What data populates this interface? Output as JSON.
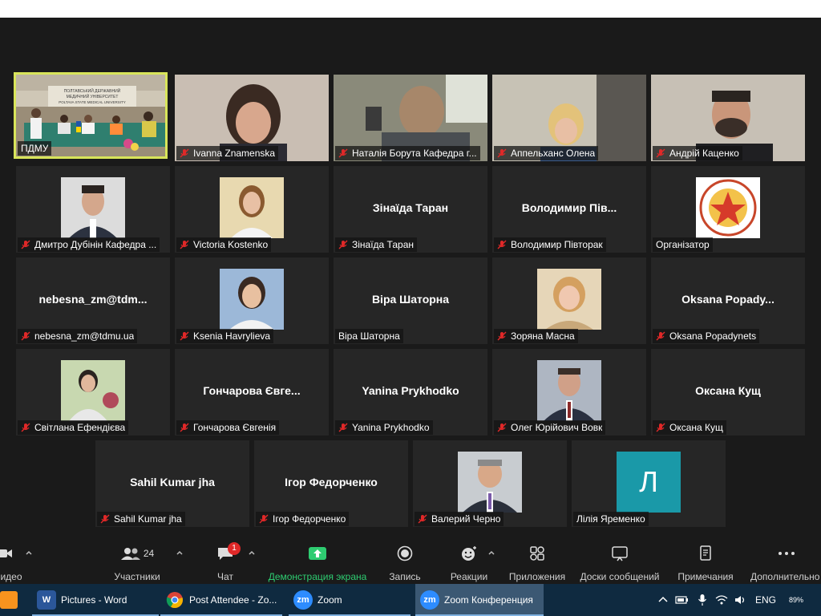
{
  "colors": {
    "active_border": "#d8e45a",
    "tile_bg": "#262626",
    "share_green": "#2ecc71",
    "badge_red": "#e02828",
    "taskbar_bg": "#0f2a40",
    "avatar_teal": "#1a99a8"
  },
  "gallery": {
    "row1": [
      {
        "label": "ПДМУ",
        "muted": false
      },
      {
        "label": "Ivanna Znamenska",
        "muted": true
      },
      {
        "label": "Наталія Борута Кафедра г...",
        "muted": true
      },
      {
        "label": "Аппельханс Олена",
        "muted": true
      },
      {
        "label": "Андрій Каценко",
        "muted": true
      }
    ],
    "row2": [
      {
        "label": "Дмитро Дубінін Кафедра ...",
        "muted": true
      },
      {
        "label": "Victoria Kostenko",
        "muted": true
      },
      {
        "center": "Зінаїда Таран",
        "label": "Зінаїда Таран",
        "muted": true
      },
      {
        "center": "Володимир  Пів...",
        "label": "Володимир Півторак",
        "muted": true
      },
      {
        "label": "Організатор",
        "muted": false
      }
    ],
    "row3": [
      {
        "center": "nebesna_zm@tdm...",
        "label": "nebesna_zm@tdmu.ua",
        "muted": true
      },
      {
        "label": "Ksenia Havrylieva",
        "muted": true
      },
      {
        "center": "Віра Шаторна",
        "label": "Віра Шаторна",
        "muted": false
      },
      {
        "label": "Зоряна Масна",
        "muted": true
      },
      {
        "center": "Oksana  Popady...",
        "label": "Oksana Popadynets",
        "muted": true
      }
    ],
    "row4": [
      {
        "label": "Світлана Ефендієва",
        "muted": true
      },
      {
        "center": "Гончарова Євге...",
        "label": "Гончарова Євгенія",
        "muted": true
      },
      {
        "center": "Yanina Prykhodko",
        "label": "Yanina Prykhodko",
        "muted": true
      },
      {
        "label": "Олег Юрійович Вовк",
        "muted": true
      },
      {
        "center": "Оксана Кущ",
        "label": "Оксана Кущ",
        "muted": true
      }
    ],
    "row5": [
      {
        "center": "Sahil Kumar jha",
        "label": "Sahil Kumar jha",
        "muted": true
      },
      {
        "center": "Ігор Федорченко",
        "label": "Ігор Федорченко",
        "muted": true
      },
      {
        "label": "Валерий Черно",
        "muted": true
      },
      {
        "label": "Лілія Яременко",
        "muted": false,
        "avatar_letter": "Л"
      }
    ]
  },
  "toolbar": {
    "video_label": "ь видео",
    "participants_label": "Участники",
    "participants_count": "24",
    "chat_label": "Чат",
    "chat_badge": "1",
    "share_label": "Демонстрация экрана",
    "record_label": "Запись",
    "reactions_label": "Реакции",
    "apps_label": "Приложения",
    "whiteboards_label": "Доски сообщений",
    "notes_label": "Примечания",
    "more_label": "Дополнительно"
  },
  "taskbar": {
    "apps": [
      {
        "label": "Pictures - Word",
        "icon": "word-icon"
      },
      {
        "label": "Post Attendee - Zo...",
        "icon": "chrome-icon"
      },
      {
        "label": "Zoom",
        "icon": "zoom-icon"
      },
      {
        "label": "Zoom Конференция",
        "icon": "zoom-icon"
      }
    ],
    "lang": "ENG",
    "tray_badge": "89%",
    "zoom_icon_text": "zm",
    "word_icon_text": "W"
  },
  "video_content": {
    "banner_line1": "ПОЛТАВСЬКИЙ ДЕРЖАВНИЙ",
    "banner_line2": "МЕДИЧНИЙ УНІВЕРСИТЕТ",
    "banner_line3": "POLTAVA STATE MEDICAL UNIVERSITY"
  }
}
